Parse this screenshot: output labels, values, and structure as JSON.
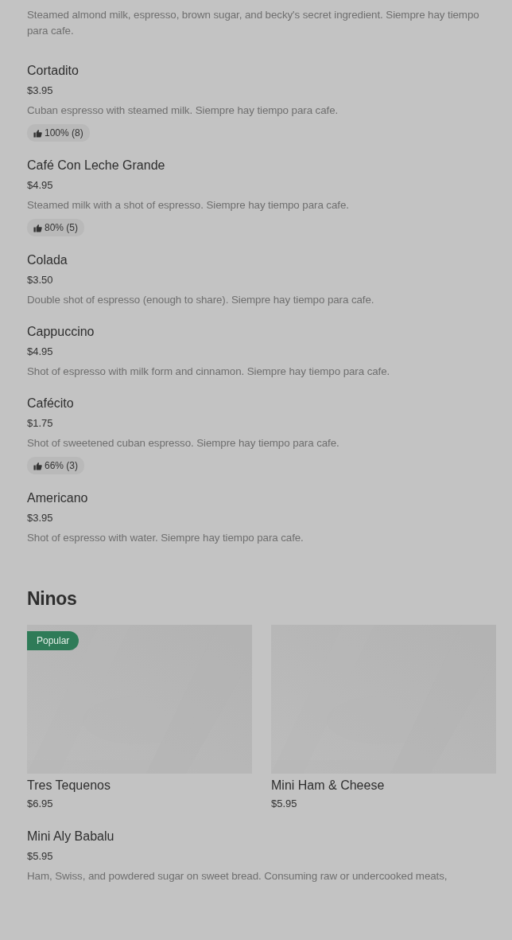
{
  "top_item": {
    "description": "Steamed almond milk, espresso, brown sugar, and becky's secret ingredient. Siempre hay tiempo para cafe."
  },
  "items": [
    {
      "name": "Cortadito",
      "price": "$3.95",
      "description": "Cuban espresso with steamed milk. Siempre hay tiempo para cafe.",
      "rating": "100% (8)"
    },
    {
      "name": "Café Con Leche Grande",
      "price": "$4.95",
      "description": "Steamed milk with a shot of espresso. Siempre hay tiempo para cafe.",
      "rating": "80% (5)"
    },
    {
      "name": "Colada",
      "price": "$3.50",
      "description": "Double shot of espresso (enough to share). Siempre hay tiempo para cafe."
    },
    {
      "name": "Cappuccino",
      "price": "$4.95",
      "description": "Shot of espresso with milk form and cinnamon. Siempre hay tiempo para cafe."
    },
    {
      "name": "Cafécito",
      "price": "$1.75",
      "description": "Shot of sweetened cuban espresso. Siempre hay tiempo para cafe.",
      "rating": "66% (3)"
    },
    {
      "name": "Americano",
      "price": "$3.95",
      "description": "Shot of espresso with water. Siempre hay tiempo para cafe."
    }
  ],
  "section": {
    "title": "Ninos",
    "cards": [
      {
        "kind": "picture",
        "badge": "Popular",
        "name": "Tres Tequenos",
        "price": "$6.95"
      },
      {
        "kind": "picture",
        "name": "Mini Ham & Cheese",
        "price": "$5.95"
      }
    ],
    "items": [
      {
        "name": "Mini Aly Babalu",
        "price": "$5.95",
        "description": "Ham, Swiss, and powdered sugar on sweet bread. Consuming raw or undercooked meats,"
      }
    ]
  }
}
